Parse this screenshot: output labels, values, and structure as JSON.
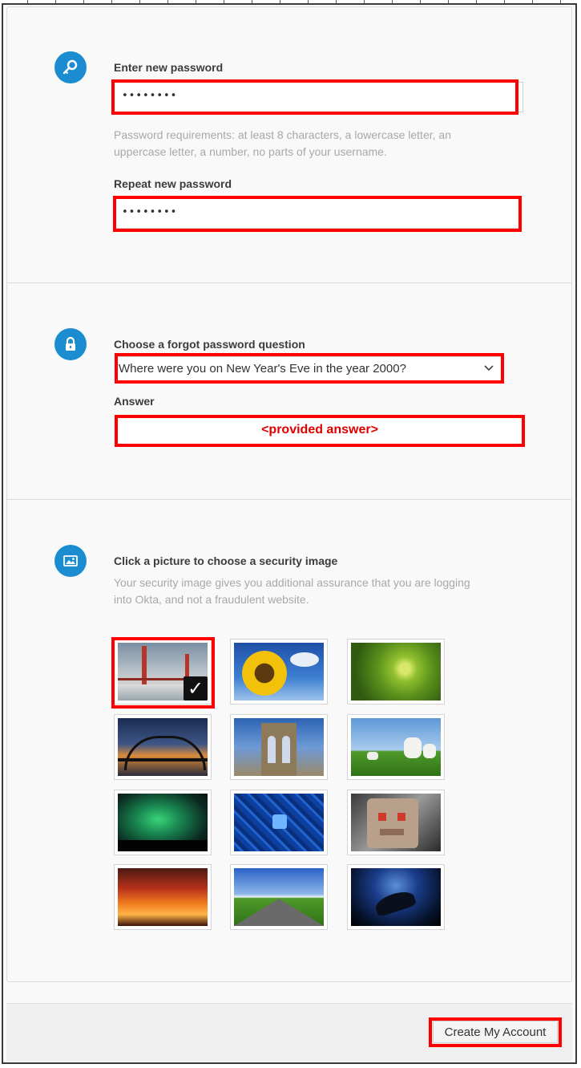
{
  "password_section": {
    "new_label": "Enter new password",
    "new_value": "••••••••",
    "requirements_line1": "Password requirements: at least 8 characters, a lowercase letter, an",
    "requirements_line2": "uppercase letter, a number, no parts of your username.",
    "repeat_label": "Repeat new password",
    "repeat_value": "••••••••"
  },
  "question_section": {
    "question_label": "Choose a forgot password question",
    "selected_question": "Where were you on New Year's Eve in the year 2000?",
    "answer_label": "Answer",
    "answer_value": "<provided answer>"
  },
  "image_section": {
    "title": "Click a picture to choose a security image",
    "desc_line1": "Your security image gives you additional assurance that you are logging",
    "desc_line2": "into Okta, and not a fraudulent website.",
    "selected_mark": "✓",
    "images": [
      {
        "name": "golden-gate-bridge",
        "selected": true
      },
      {
        "name": "sunflower",
        "selected": false
      },
      {
        "name": "succulent-plant",
        "selected": false
      },
      {
        "name": "harbour-bridge",
        "selected": false
      },
      {
        "name": "brooklyn-bridge",
        "selected": false
      },
      {
        "name": "lambs-in-field",
        "selected": false
      },
      {
        "name": "aurora",
        "selected": false
      },
      {
        "name": "circuit-board",
        "selected": false
      },
      {
        "name": "robot",
        "selected": false
      },
      {
        "name": "sunset-clouds",
        "selected": false
      },
      {
        "name": "road",
        "selected": false
      },
      {
        "name": "manta-ray",
        "selected": false
      }
    ]
  },
  "footer": {
    "submit_label": "Create My Account"
  },
  "colors": {
    "accent": "#1a8ccf",
    "annotation_red": "#ff0000"
  }
}
